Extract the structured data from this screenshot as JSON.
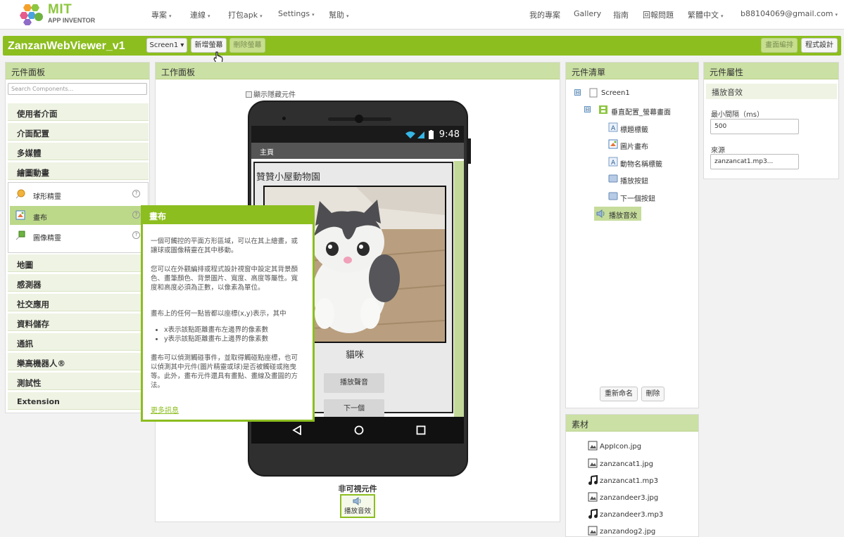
{
  "topbar": {
    "logo_mit": "MIT",
    "logo_app_inventor": "APP INVENTOR",
    "menus": [
      {
        "label": "專案",
        "caret": "▾"
      },
      {
        "label": "連線",
        "caret": "▾"
      },
      {
        "label": "打包apk",
        "caret": "▾"
      },
      {
        "label": "Settings",
        "caret": "▾"
      },
      {
        "label": "幫助",
        "caret": "▾"
      }
    ],
    "links": [
      "我的專案",
      "Gallery",
      "指南",
      "回報問題"
    ],
    "language": {
      "label": "繁體中文",
      "caret": "▾"
    },
    "account": {
      "label": "b88104069@gmail.com",
      "caret": "▾"
    }
  },
  "project": {
    "title": "ZanzanWebViewer_v1",
    "screen_select": "Screen1 ▾",
    "add_screen": "新增螢幕",
    "remove_screen": "刪除螢幕",
    "designer": "畫面編排",
    "blocks": "程式設計"
  },
  "palette": {
    "title": "元件面板",
    "search_placeholder": "Search Components...",
    "categories_top": [
      "使用者介面",
      "介面配置",
      "多媒體",
      "繪圖動畫"
    ],
    "drawing_items": [
      {
        "label": "球形精靈",
        "help": "?"
      },
      {
        "label": "畫布",
        "help": "?"
      },
      {
        "label": "圖像精靈",
        "help": "?"
      }
    ],
    "categories_bottom": [
      "地圖",
      "感測器",
      "社交應用",
      "資料儲存",
      "通訊",
      "樂高機器人®",
      "測試性",
      "Extension"
    ]
  },
  "tooltip": {
    "title": "畫布",
    "p1": "一個可觸控的平面方形區域，可以在其上繪畫，或讓球或圖像精靈在其中移動。",
    "p2": "您可以在外觀編排或程式設計視窗中設定其背景顏色、畫筆顏色、背景圖片、寬度、高度等屬性。寬度和高度必須為正數，以像素為單位。",
    "p3": "畫布上的任何一點皆都以座標(x,y)表示，其中",
    "bullets": [
      "x表示該點距離畫布左邊界的像素數",
      "y表示該點距離畫布上邊界的像素數"
    ],
    "p4": "畫布可以偵測觸碰事件，並取得觸碰點座標，也可以偵測其中元件(圖片精靈或球)是否被觸碰或拖曳等。此外，畫布元件還具有畫點、畫線及畫圓的方法。",
    "more": "更多訊息"
  },
  "viewer": {
    "title": "工作面板",
    "show_hidden": "顯示隱藏元件",
    "status_time": "9:48",
    "app_title": "主頁",
    "title_label": "贊贊小屋動物園",
    "animal_name": "貓咪",
    "play_button": "播放聲音",
    "next_button": "下一個",
    "nonvisible_title": "非可視元件",
    "nonvisible_item": "播放音效"
  },
  "components": {
    "title": "元件清單",
    "tree": [
      {
        "label": "Screen1",
        "toggle": "⊟"
      },
      {
        "label": "垂直配置_螢幕畫面",
        "toggle": "⊟"
      },
      {
        "label": "標題標籤"
      },
      {
        "label": "圖片畫布"
      },
      {
        "label": "動物名稱標籤"
      },
      {
        "label": "播放按鈕"
      },
      {
        "label": "下一個按鈕"
      },
      {
        "label": "播放音效"
      }
    ],
    "rename": "重新命名",
    "delete": "刪除"
  },
  "properties": {
    "title": "元件屬性",
    "component": "播放音效",
    "min_interval_label": "最小間隔（ms）",
    "min_interval_value": "500",
    "source_label": "來源",
    "source_value": "zanzancat1.mp3..."
  },
  "media": {
    "title": "素材",
    "files": [
      {
        "name": "AppIcon.jpg",
        "icon": "image-icon"
      },
      {
        "name": "zanzancat1.jpg",
        "icon": "image-icon"
      },
      {
        "name": "zanzancat1.mp3",
        "icon": "music-note-icon"
      },
      {
        "name": "zanzandeer3.jpg",
        "icon": "image-icon"
      },
      {
        "name": "zanzandeer3.mp3",
        "icon": "music-note-icon"
      },
      {
        "name": "zanzandog2.jpg",
        "icon": "image-icon"
      }
    ]
  },
  "colors": {
    "brand_green": "#8cbe1f",
    "panel_header": "#cbe0a4",
    "selection": "#bcd98a"
  }
}
